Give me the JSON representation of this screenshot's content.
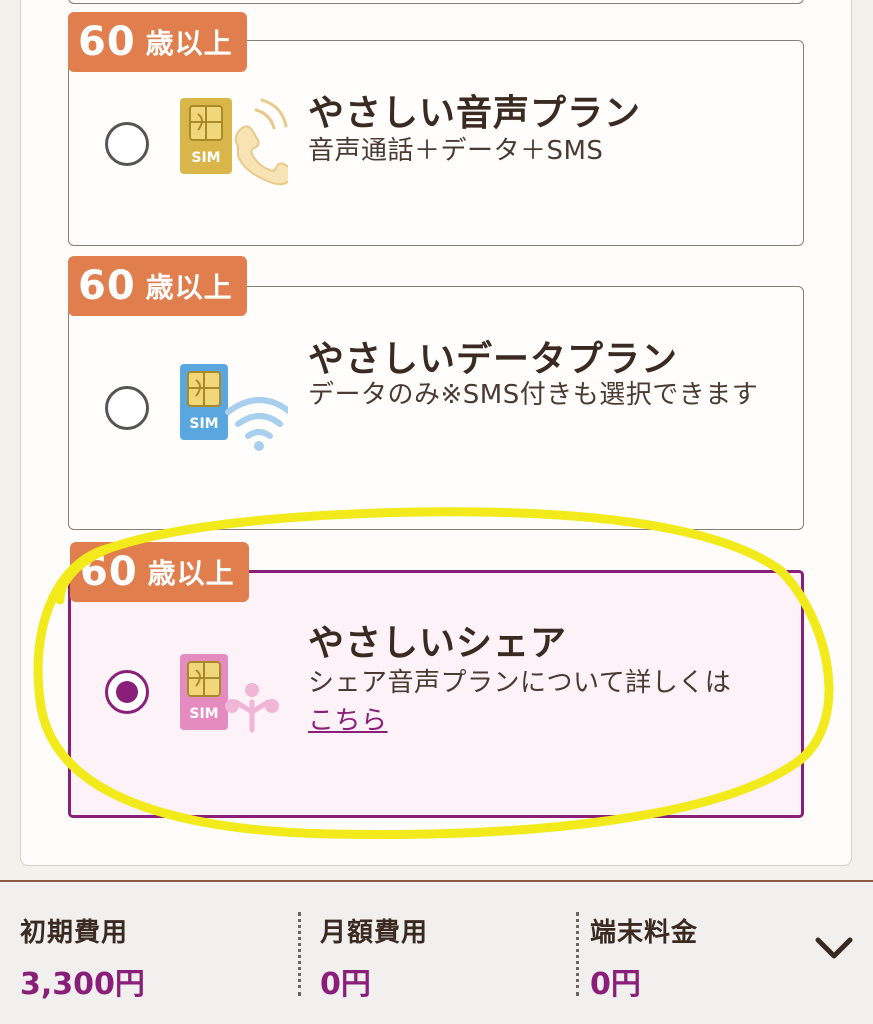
{
  "plans": [
    {
      "badge_num": "60",
      "badge_text": "歳以上",
      "title": "やさしい音声プラン",
      "desc": "音声通話＋データ＋SMS",
      "icon": "voice-sim-icon",
      "selected": false
    },
    {
      "badge_num": "60",
      "badge_text": "歳以上",
      "title": "やさしいデータプラン",
      "desc": "データのみ※SMS付きも選択できます",
      "icon": "data-sim-icon",
      "selected": false
    },
    {
      "badge_num": "60",
      "badge_text": "歳以上",
      "title": "やさしいシェア",
      "desc": "シェア音声プランについて詳しくは",
      "link": "こちら",
      "icon": "share-sim-icon",
      "selected": true
    }
  ],
  "fees": [
    {
      "label": "初期費用",
      "value": "3,300円"
    },
    {
      "label": "月額費用",
      "value": "0円"
    },
    {
      "label": "端末料金",
      "value": "0円"
    }
  ],
  "icons": {
    "expand": "chevron-down-icon"
  },
  "colors": {
    "accent": "#8a1f7a",
    "badge": "#e07e4e",
    "highlight": "#f2ea1a",
    "sim_gold": "#d8b64a",
    "sim_blue": "#5aa7e0",
    "sim_pink": "#e48cc0"
  }
}
